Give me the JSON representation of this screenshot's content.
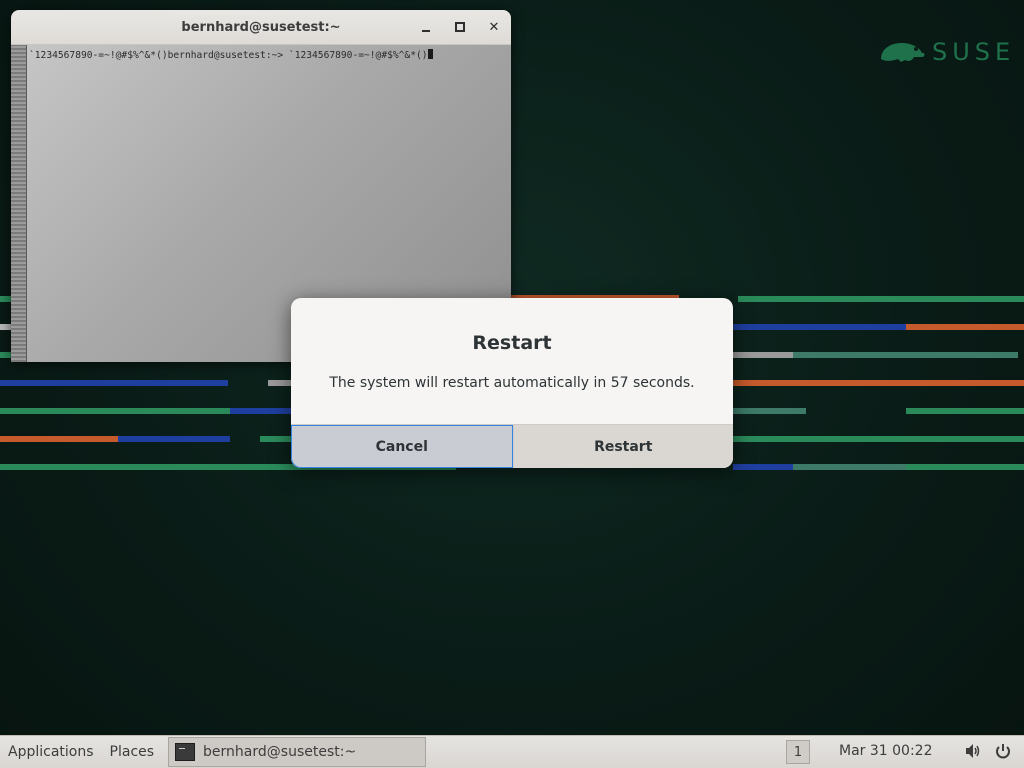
{
  "colors": {
    "suse_green": "#30ba78",
    "focus_blue": "#3584e4"
  },
  "logo": {
    "text": "SUSE"
  },
  "terminal": {
    "title": "bernhard@susetest:~",
    "line": "`1234567890-=~!@#$%^&*()bernhard@susetest:~> `1234567890-=~!@#$%^&*()"
  },
  "dialog": {
    "title": "Restart",
    "message": "The system will restart automatically in 57 seconds.",
    "cancel_label": "Cancel",
    "restart_label": "Restart"
  },
  "panel": {
    "applications_label": "Applications",
    "places_label": "Places",
    "task_label": "bernhard@susetest:~",
    "workspace": "1",
    "clock": "Mar 31  00:22"
  }
}
